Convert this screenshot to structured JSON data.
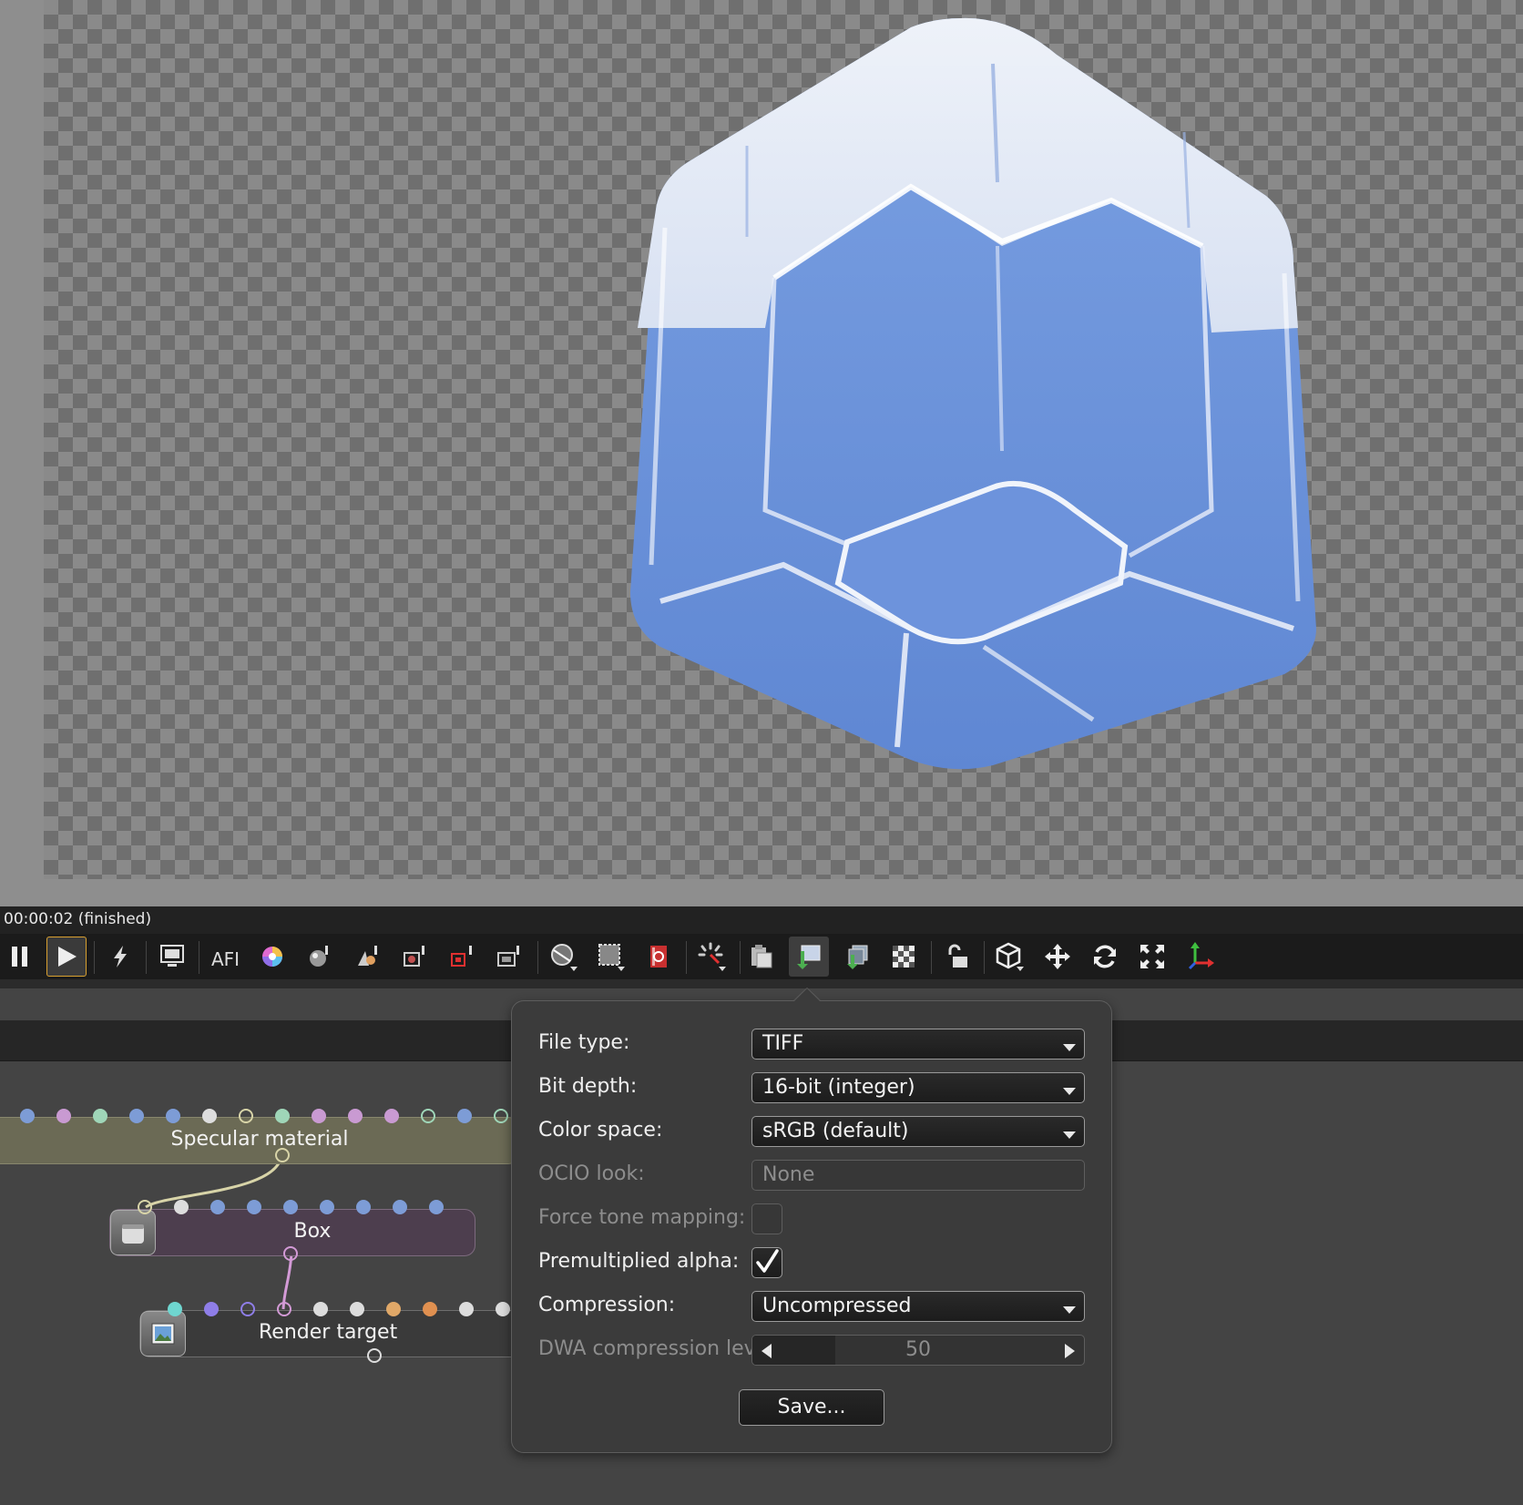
{
  "status": {
    "text": "00:00:02 (finished)"
  },
  "nodes": {
    "specular": {
      "label": "Specular material"
    },
    "box": {
      "label": "Box"
    },
    "render_target": {
      "label": "Render target"
    }
  },
  "export_popup": {
    "file_type": {
      "label": "File type:",
      "value": "TIFF"
    },
    "bit_depth": {
      "label": "Bit depth:",
      "value": "16-bit (integer)"
    },
    "color_space": {
      "label": "Color space:",
      "value": "sRGB (default)"
    },
    "ocio_look": {
      "label": "OCIO look:",
      "value": "None"
    },
    "force_tone_mapping": {
      "label": "Force tone mapping:",
      "checked": false
    },
    "premultiplied_alpha": {
      "label": "Premultiplied alpha:",
      "checked": true
    },
    "compression": {
      "label": "Compression:",
      "value": "Uncompressed"
    },
    "dwa_level": {
      "label": "DWA compression level:",
      "value": "50"
    },
    "save_label": "Save..."
  },
  "colors": {
    "accent_active": "#d8a030",
    "viewport_bg": "#8e8e8e",
    "panel_bg": "#444444",
    "popup_bg": "#3b3b3b",
    "specular_node": "#6b6a55",
    "box_node": "#4d3e4e",
    "render_target_node": "#3a3a3a"
  },
  "icons": {
    "toolbar": [
      "pause-icon",
      "play-icon",
      "lightning-icon",
      "monitor-icon",
      "afi-icon",
      "color-wheel-icon",
      "sphere-picker-icon",
      "material-picker-icon",
      "object-picker-icon",
      "camera-target-icon",
      "focus-icon",
      "region-render-icon",
      "film-region-icon",
      "clay-mode-icon",
      "render-priority-icon",
      "copy-clipboard-icon",
      "save-render-icon",
      "export-passes-icon",
      "background-alpha-icon",
      "lock-icon",
      "cube-icon",
      "move-icon",
      "rotate-icon",
      "fullscreen-icon",
      "axis-gizmo-icon"
    ]
  }
}
